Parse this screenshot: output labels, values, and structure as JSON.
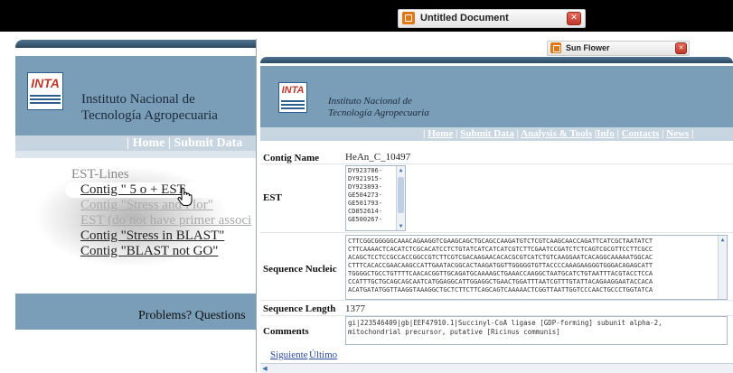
{
  "back_window": {
    "tab_title": "Untitled Document",
    "logo": "INTA",
    "institute_line1": "Instituto Nacional de",
    "institute_line2": "Tecnología Agropecuaria",
    "nav": "| Home | Submit Data",
    "links": [
      "EST-Lines",
      "Contig \" 5 o + EST",
      "Contig \"Stress and Flor\"",
      "EST (do not have primer associ",
      "Contig \"Stress in BLAST\"",
      "Contig \"BLAST not GO\""
    ],
    "footer_text": "Problems? Questions"
  },
  "front_window": {
    "tab_title": "Sun Flower",
    "logo": "INTA",
    "institute_line1": "Instituto Nacional de",
    "institute_line2": "Tecnología Agropecuaria",
    "nav": [
      "Home",
      "Submit Data",
      "Analysis & Tools",
      "Info",
      "Contacts",
      "News"
    ],
    "contig_name_label": "Contig Name",
    "contig_name": "HeAn_C_10497",
    "est_label": "EST",
    "est_items": [
      "DY923786-",
      "DY921915-",
      "DY923893-",
      "GE504273-",
      "GE501793-",
      "CD852614-",
      "GE500267-"
    ],
    "sequence_label": "Sequence Nucleic",
    "sequence_lines": [
      "CTTCGGCGGGGGCAAACAGAAGGTCGAAGCAGCTGCAGCCAAGATGTCTCGTCAAGCAACCAGATTCATCGCTAATATCT",
      "CTTCAAAACTCACATCTCGCACATCCTCTGTATCATCATCATCGTCTTCGAATCCGATCTCTCAGTCGCGTTCCTTCGCC",
      "ACAGCTCCTCCGCCACCGGCCGTCTTCGTCGACAAGAACACACGCGTCATCTGTCAAGGAATCACAGGCAAAAATGGCAC",
      "CTTTCACACCGAACAAGCCATTGAATACGGCACTAAGATGGTTGGGGGTGTTACCCCAAAGAAGGGTGGGACAGAGCATT",
      "TGGGGCTGCCTGTTTTCAACACGGTTGCAGATGCAAAAGCTGAAACCAAGGCTAATGCATCTGTAATTTACGTACCTCCA",
      "CCATTTGCTGCAGCAGCAATCATGGAGGCATTGGAGGCTGAACTGGATTTAATCGTTTGTATTACAGAAGGAATACCACA",
      "ACATGATATGGTTAAGGTAAAGGCTGCTCTTCTTCAGCAGTCAAAAACTCGGTTAATTGGTCCCAACTGCCCTGGTATCA"
    ],
    "length_label": "Sequence Length",
    "length_value": "1377",
    "comments_label": "Comments",
    "comments_line1": "gi|223546409|gb|EEF47910.1|Succinyl-CoA ligase [GDP-forming] subunit alpha-2,",
    "comments_line2": "mitochondrial precursor, putative [Ricinus communis]",
    "next_link": "Siguiente",
    "last_link": "Último"
  }
}
